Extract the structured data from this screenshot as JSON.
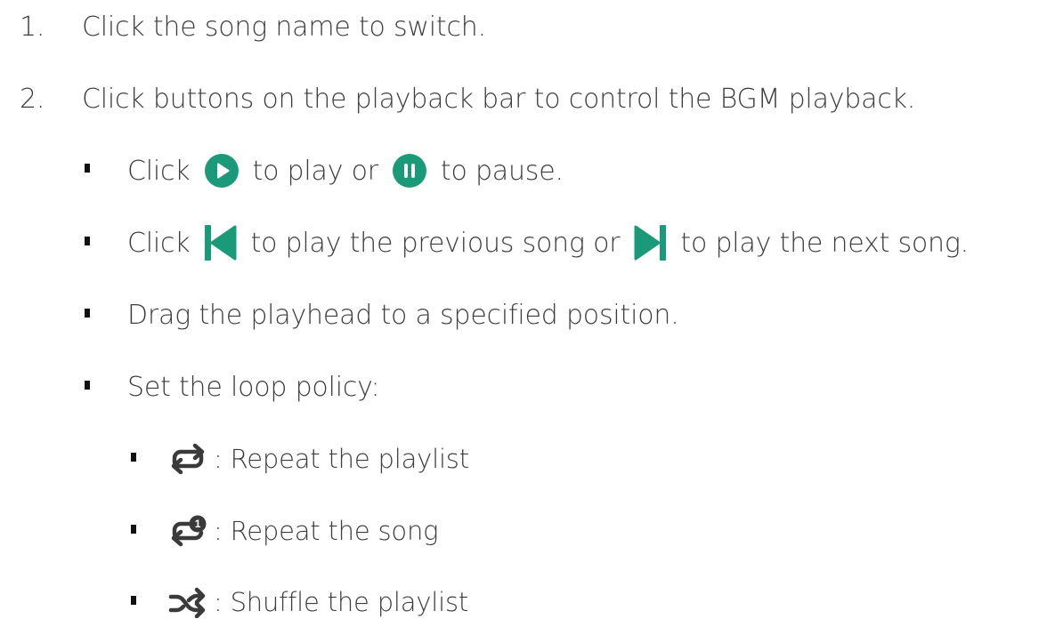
{
  "steps": [
    {
      "number": "1.",
      "text": "Click the song name to switch."
    },
    {
      "number": "2.",
      "text": "Click buttons on the playback bar to control the BGM playback."
    }
  ],
  "play_pause": {
    "prefix": "Click",
    "mid": "to play or",
    "suffix": "to pause.",
    "play_icon": "play-circle-icon",
    "pause_icon": "pause-circle-icon"
  },
  "prev_next": {
    "prefix": "Click",
    "mid": "to play the previous song or",
    "suffix": "to play the next song.",
    "prev_icon": "skip-previous-icon",
    "next_icon": "skip-next-icon"
  },
  "drag_text": "Drag the playhead to a specified position.",
  "loop": {
    "label": "Set the loop policy:",
    "options": [
      {
        "icon": "repeat-icon",
        "text": ": Repeat the playlist"
      },
      {
        "icon": "repeat-one-icon",
        "badge": "1",
        "text": ": Repeat the song"
      },
      {
        "icon": "shuffle-icon",
        "text": ": Shuffle the playlist"
      }
    ]
  },
  "colors": {
    "accent": "#1a9a78",
    "text": "#3d3d3d",
    "icon_dark": "#3a3a3a"
  }
}
